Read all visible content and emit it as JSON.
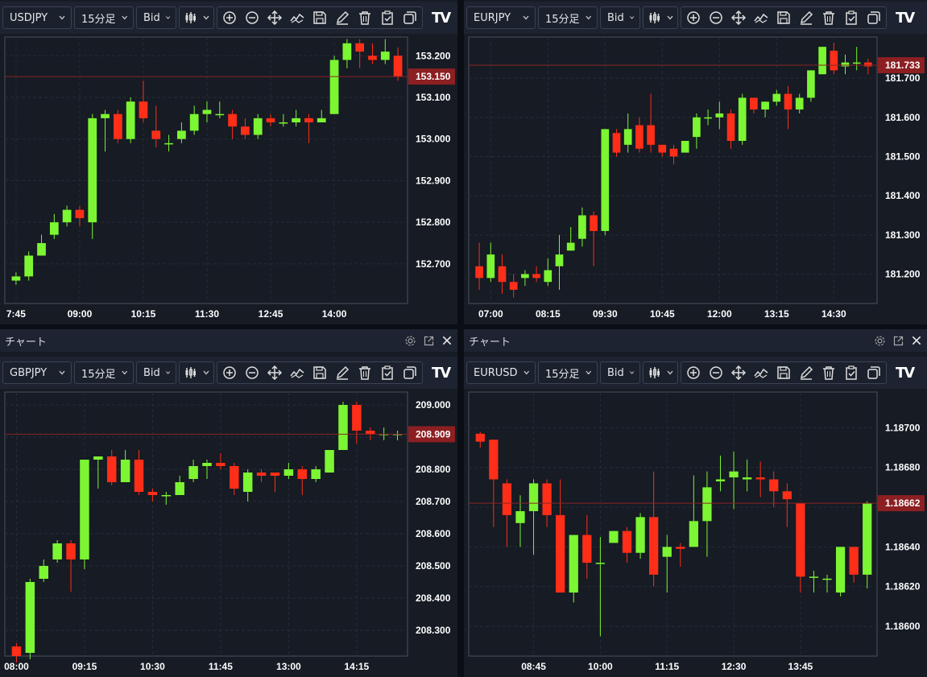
{
  "window_title": "チャート",
  "toolbar": {
    "timeframe": "15分足",
    "price_side": "Bid",
    "logo": "TV"
  },
  "colors": {
    "up": "#7cf532",
    "down": "#ff2e18",
    "grid": "#252c38",
    "axis_text": "#ffffff",
    "price_line": "#8b2424",
    "price_label_bg": "#8c1f22"
  },
  "icons": [
    "candles-icon",
    "zoom-in-icon",
    "zoom-out-icon",
    "move-icon",
    "indicator-icon",
    "save-icon",
    "draw-icon",
    "delete-icon",
    "checklist-icon",
    "copy-icon",
    "settings-icon",
    "popout-icon",
    "close-icon"
  ],
  "charts": [
    {
      "symbol": "USDJPY",
      "has_title": false,
      "chart_data": {
        "type": "candlestick",
        "y_ticks": [
          "153.200",
          "153.100",
          "153.000",
          "152.900",
          "152.800",
          "152.700"
        ],
        "ylim": [
          152.605,
          153.245
        ],
        "x_ticks": [
          {
            "label": "7:45",
            "index": 0
          },
          {
            "label": "09:00",
            "index": 5
          },
          {
            "label": "10:15",
            "index": 10
          },
          {
            "label": "11:30",
            "index": 15
          },
          {
            "label": "12:45",
            "index": 20
          },
          {
            "label": "14:00",
            "index": 25
          }
        ],
        "current_price": "153.150",
        "candles": [
          [
            152.66,
            152.67,
            152.65,
            152.68
          ],
          [
            152.67,
            152.72,
            152.66,
            152.73
          ],
          [
            152.72,
            152.75,
            152.72,
            152.77
          ],
          [
            152.77,
            152.8,
            152.76,
            152.82
          ],
          [
            152.8,
            152.83,
            152.79,
            152.84
          ],
          [
            152.83,
            152.81,
            152.79,
            152.84
          ],
          [
            152.8,
            153.05,
            152.76,
            153.06
          ],
          [
            153.05,
            153.06,
            152.97,
            153.07
          ],
          [
            153.06,
            153.0,
            152.99,
            153.07
          ],
          [
            153.0,
            153.09,
            152.99,
            153.1
          ],
          [
            153.09,
            153.05,
            153.04,
            153.14
          ],
          [
            153.02,
            153.0,
            152.98,
            153.08
          ],
          [
            152.99,
            152.99,
            152.97,
            153.01
          ],
          [
            153.0,
            153.02,
            152.99,
            153.04
          ],
          [
            153.02,
            153.06,
            153.01,
            153.08
          ],
          [
            153.06,
            153.07,
            153.04,
            153.09
          ],
          [
            153.06,
            153.06,
            153.05,
            153.09
          ],
          [
            153.06,
            153.03,
            153.0,
            153.07
          ],
          [
            153.03,
            153.01,
            153.0,
            153.05
          ],
          [
            153.01,
            153.05,
            153.0,
            153.06
          ],
          [
            153.05,
            153.04,
            153.03,
            153.06
          ],
          [
            153.04,
            153.04,
            153.03,
            153.06
          ],
          [
            153.04,
            153.05,
            153.03,
            153.07
          ],
          [
            153.05,
            153.04,
            152.99,
            153.06
          ],
          [
            153.04,
            153.05,
            153.04,
            153.07
          ],
          [
            153.06,
            153.19,
            153.06,
            153.2
          ],
          [
            153.19,
            153.23,
            153.17,
            153.24
          ],
          [
            153.23,
            153.21,
            153.17,
            153.24
          ],
          [
            153.2,
            153.19,
            153.18,
            153.23
          ],
          [
            153.19,
            153.21,
            153.18,
            153.24
          ],
          [
            153.2,
            153.15,
            153.14,
            153.22
          ]
        ]
      }
    },
    {
      "symbol": "EURJPY",
      "has_title": false,
      "chart_data": {
        "type": "candlestick",
        "y_ticks": [
          "181.700",
          "181.600",
          "181.500",
          "181.400",
          "181.300",
          "181.200"
        ],
        "ylim": [
          181.125,
          181.805
        ],
        "x_ticks": [
          {
            "label": "07:00",
            "index": 1
          },
          {
            "label": "08:15",
            "index": 6
          },
          {
            "label": "09:30",
            "index": 11
          },
          {
            "label": "10:45",
            "index": 16
          },
          {
            "label": "12:00",
            "index": 21
          },
          {
            "label": "13:15",
            "index": 26
          },
          {
            "label": "14:30",
            "index": 31
          }
        ],
        "current_price": "181.733",
        "candles": [
          [
            181.22,
            181.19,
            181.16,
            181.28
          ],
          [
            181.19,
            181.25,
            181.18,
            181.28
          ],
          [
            181.22,
            181.18,
            181.15,
            181.25
          ],
          [
            181.18,
            181.16,
            181.14,
            181.2
          ],
          [
            181.19,
            181.2,
            181.17,
            181.21
          ],
          [
            181.2,
            181.19,
            181.18,
            181.22
          ],
          [
            181.18,
            181.21,
            181.17,
            181.24
          ],
          [
            181.22,
            181.25,
            181.16,
            181.3
          ],
          [
            181.26,
            181.28,
            181.26,
            181.32
          ],
          [
            181.29,
            181.35,
            181.27,
            181.37
          ],
          [
            181.35,
            181.31,
            181.22,
            181.36
          ],
          [
            181.31,
            181.57,
            181.3,
            181.57
          ],
          [
            181.56,
            181.51,
            181.5,
            181.57
          ],
          [
            181.53,
            181.57,
            181.51,
            181.61
          ],
          [
            181.58,
            181.52,
            181.51,
            181.6
          ],
          [
            181.58,
            181.53,
            181.51,
            181.66
          ],
          [
            181.53,
            181.51,
            181.5,
            181.53
          ],
          [
            181.52,
            181.5,
            181.48,
            181.53
          ],
          [
            181.51,
            181.54,
            181.51,
            181.54
          ],
          [
            181.55,
            181.6,
            181.52,
            181.61
          ],
          [
            181.6,
            181.6,
            181.58,
            181.62
          ],
          [
            181.6,
            181.61,
            181.57,
            181.64
          ],
          [
            181.61,
            181.54,
            181.52,
            181.62
          ],
          [
            181.54,
            181.65,
            181.53,
            181.66
          ],
          [
            181.65,
            181.62,
            181.61,
            181.65
          ],
          [
            181.62,
            181.64,
            181.6,
            181.64
          ],
          [
            181.64,
            181.66,
            181.63,
            181.67
          ],
          [
            181.66,
            181.62,
            181.57,
            181.68
          ],
          [
            181.62,
            181.65,
            181.61,
            181.66
          ],
          [
            181.65,
            181.72,
            181.64,
            181.72
          ],
          [
            181.71,
            181.78,
            181.71,
            181.78
          ],
          [
            181.77,
            181.72,
            181.71,
            181.79
          ],
          [
            181.73,
            181.74,
            181.71,
            181.76
          ],
          [
            181.74,
            181.74,
            181.72,
            181.78
          ],
          [
            181.74,
            181.73,
            181.71,
            181.75
          ]
        ]
      }
    },
    {
      "symbol": "GBPJPY",
      "has_title": true,
      "chart_data": {
        "type": "candlestick",
        "y_ticks": [
          "209.000",
          "208.900",
          "208.800",
          "208.700",
          "208.600",
          "208.500",
          "208.400",
          "208.300"
        ],
        "ylim": [
          208.22,
          209.04
        ],
        "x_ticks": [
          {
            "label": "08:00",
            "index": 0
          },
          {
            "label": "09:15",
            "index": 5
          },
          {
            "label": "10:30",
            "index": 10
          },
          {
            "label": "11:45",
            "index": 15
          },
          {
            "label": "13:00",
            "index": 20
          },
          {
            "label": "14:15",
            "index": 25
          }
        ],
        "current_price": "208.909",
        "candles": [
          [
            208.25,
            208.22,
            208.2,
            208.26
          ],
          [
            208.23,
            208.45,
            208.21,
            208.46
          ],
          [
            208.46,
            208.5,
            208.45,
            208.52
          ],
          [
            208.52,
            208.57,
            208.51,
            208.58
          ],
          [
            208.57,
            208.52,
            208.42,
            208.58
          ],
          [
            208.52,
            208.83,
            208.49,
            208.83
          ],
          [
            208.83,
            208.84,
            208.74,
            208.84
          ],
          [
            208.84,
            208.76,
            208.75,
            208.86
          ],
          [
            208.76,
            208.83,
            208.76,
            208.86
          ],
          [
            208.83,
            208.73,
            208.72,
            208.86
          ],
          [
            208.73,
            208.72,
            208.7,
            208.74
          ],
          [
            208.72,
            208.72,
            208.69,
            208.73
          ],
          [
            208.72,
            208.76,
            208.72,
            208.78
          ],
          [
            208.77,
            208.81,
            208.76,
            208.83
          ],
          [
            208.81,
            208.82,
            208.77,
            208.83
          ],
          [
            208.82,
            208.81,
            208.8,
            208.85
          ],
          [
            208.81,
            208.74,
            208.72,
            208.82
          ],
          [
            208.73,
            208.79,
            208.7,
            208.8
          ],
          [
            208.79,
            208.78,
            208.76,
            208.8
          ],
          [
            208.79,
            208.78,
            208.73,
            208.79
          ],
          [
            208.78,
            208.8,
            208.77,
            208.82
          ],
          [
            208.8,
            208.77,
            208.72,
            208.81
          ],
          [
            208.77,
            208.8,
            208.76,
            208.81
          ],
          [
            208.79,
            208.86,
            208.79,
            208.86
          ],
          [
            208.86,
            209.0,
            208.86,
            209.01
          ],
          [
            209.0,
            208.92,
            208.88,
            209.01
          ],
          [
            208.92,
            208.91,
            208.89,
            208.93
          ],
          [
            208.91,
            208.91,
            208.89,
            208.93
          ],
          [
            208.91,
            208.91,
            208.89,
            208.92
          ]
        ]
      }
    },
    {
      "symbol": "EURUSD",
      "has_title": true,
      "chart_data": {
        "type": "candlestick",
        "y_ticks": [
          "1.18700",
          "1.18680",
          "1.18660",
          "1.18640",
          "1.18620",
          "1.18600"
        ],
        "ylim": [
          1.18585,
          1.18718
        ],
        "x_ticks": [
          {
            "label": "08:45",
            "index": 4
          },
          {
            "label": "10:00",
            "index": 9
          },
          {
            "label": "11:15",
            "index": 14
          },
          {
            "label": "12:30",
            "index": 19
          },
          {
            "label": "13:45",
            "index": 24
          }
        ],
        "current_price": "1.18662",
        "candles": [
          [
            1.18697,
            1.18693,
            1.1869,
            1.18698
          ],
          [
            1.18694,
            1.18674,
            1.1865,
            1.18694
          ],
          [
            1.18672,
            1.18656,
            1.1864,
            1.18674
          ],
          [
            1.18652,
            1.18658,
            1.1864,
            1.18666
          ],
          [
            1.18658,
            1.18672,
            1.18636,
            1.18674
          ],
          [
            1.18672,
            1.18656,
            1.1865,
            1.18674
          ],
          [
            1.18656,
            1.18617,
            1.18617,
            1.18674
          ],
          [
            1.18617,
            1.18646,
            1.18612,
            1.18646
          ],
          [
            1.18646,
            1.18632,
            1.18624,
            1.18656
          ],
          [
            1.18632,
            1.18632,
            1.18595,
            1.18645
          ],
          [
            1.18642,
            1.18648,
            1.18643,
            1.18648
          ],
          [
            1.18648,
            1.18637,
            1.18632,
            1.1865
          ],
          [
            1.18637,
            1.18655,
            1.18634,
            1.18657
          ],
          [
            1.18655,
            1.18626,
            1.1862,
            1.18678
          ],
          [
            1.18635,
            1.1864,
            1.18617,
            1.18646
          ],
          [
            1.1864,
            1.18639,
            1.1863,
            1.18642
          ],
          [
            1.1864,
            1.18653,
            1.1864,
            1.18676
          ],
          [
            1.18653,
            1.1867,
            1.18635,
            1.18678
          ],
          [
            1.18673,
            1.18674,
            1.18668,
            1.18686
          ],
          [
            1.18675,
            1.18678,
            1.18659,
            1.18688
          ],
          [
            1.18674,
            1.18675,
            1.18668,
            1.18684
          ],
          [
            1.18675,
            1.18674,
            1.18665,
            1.18683
          ],
          [
            1.18674,
            1.18668,
            1.1866,
            1.18678
          ],
          [
            1.18668,
            1.18664,
            1.1865,
            1.18672
          ],
          [
            1.18662,
            1.18625,
            1.18617,
            1.18662
          ],
          [
            1.18625,
            1.18625,
            1.18617,
            1.18628
          ],
          [
            1.18624,
            1.18624,
            1.18617,
            1.18626
          ],
          [
            1.18617,
            1.1864,
            1.18615,
            1.1864
          ],
          [
            1.1864,
            1.18626,
            1.18622,
            1.1864
          ],
          [
            1.18626,
            1.18662,
            1.18619,
            1.18663
          ]
        ]
      }
    }
  ]
}
